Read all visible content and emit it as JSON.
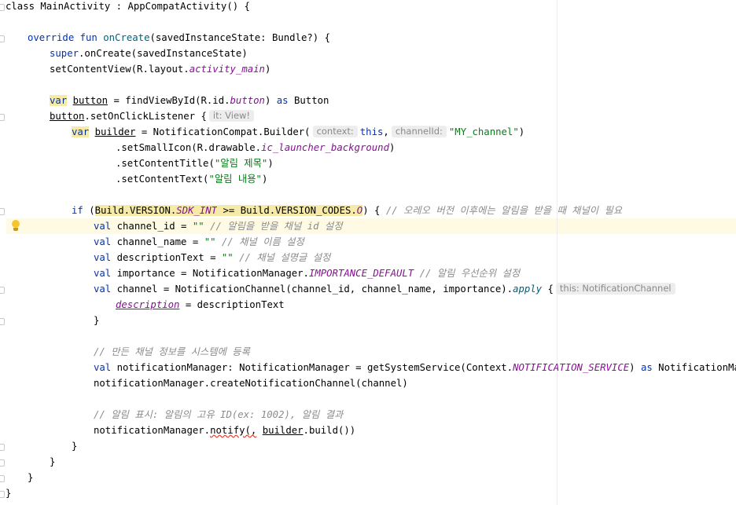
{
  "colors": {
    "keyword": "#0033b3",
    "function": "#00627a",
    "string": "#067d17",
    "comment": "#8c8c8c",
    "property": "#871094",
    "hint_bg": "#ededed",
    "current_line_bg": "#fffae3"
  },
  "icons": {
    "intention": "lightbulb-icon",
    "fold": "fold-marker-icon"
  },
  "code": {
    "l1": {
      "a": "class MainActivity : AppCompatActivity() {"
    },
    "l3": {
      "kw": "override fun ",
      "fn": "onCreate",
      "rest": "(savedInstanceState: Bundle?) {"
    },
    "l4": {
      "kw": "super",
      "rest": ".onCreate(savedInstanceState)"
    },
    "l5": {
      "a": "setContentView(R.layout.",
      "p": "activity_main",
      "b": ")"
    },
    "l7": {
      "kw": "var",
      "sp": " ",
      "var": "button",
      "a": " = findViewById(R.id.",
      "p": "button",
      "b": ") ",
      "kw2": "as",
      "c": " Button"
    },
    "l8": {
      "var": "button",
      "a": ".setOnClickListener {",
      "hint": "it: View!"
    },
    "l9": {
      "kw": "var",
      "sp": " ",
      "var": "builder",
      "a": " = NotificationCompat.Builder(",
      "hint1": "context:",
      "kw2": "this",
      "comma": ",",
      "hint2": "channelId:",
      "str": "\"MY_channel\"",
      "b": ")"
    },
    "l10": {
      "a": ".setSmallIcon(R.drawable.",
      "p": "ic_launcher_background",
      "b": ")"
    },
    "l11": {
      "a": ".setContentTitle(",
      "str": "\"알림 제목\"",
      "b": ")"
    },
    "l12": {
      "a": ".setContentText(",
      "str": "\"알림 내용\"",
      "b": ")"
    },
    "l14": {
      "kw": "if",
      "a": " (",
      "hl1": "Build.VERSION.",
      "hlp": "SDK_INT",
      "hl2": " >= Build.VERSION_CODES.",
      "hlo": "O",
      "b": ") { ",
      "cm": "// 오레오 버전 이후에는 알림을 받을 때 채널이 필요"
    },
    "l15": {
      "kw": "val",
      "a": " channel_id = ",
      "str": "\"\"",
      "sp": " ",
      "cm": "// 알림을 받을 채널 id 설정"
    },
    "l16": {
      "kw": "val",
      "a": " channel_name = ",
      "str": "\"\"",
      "sp": " ",
      "cm": "// 채널 이름 설정"
    },
    "l17": {
      "kw": "val",
      "a": " descriptionText = ",
      "str": "\"\"",
      "sp": " ",
      "cm": "// 채널 설명글 설정"
    },
    "l18": {
      "kw": "val",
      "a": " importance = NotificationManager.",
      "p": "IMPORTANCE_DEFAULT",
      "sp": " ",
      "cm": "// 알림 우선순위 설정"
    },
    "l19": {
      "kw": "val",
      "a": " channel = NotificationChannel(channel_id, channel_name, importance).",
      "fn": "apply",
      "b": " {",
      "hint": "this: NotificationChannel"
    },
    "l20": {
      "p": "description",
      "a": " = descriptionText"
    },
    "l21": {
      "a": "}"
    },
    "l23": {
      "cm": "// 만든 채널 정보를 시스템에 등록"
    },
    "l24": {
      "kw": "val",
      "a": " notificationManager: NotificationManager = getSystemService(Context.",
      "p": "NOTIFICATION_SERVICE",
      "b": ") ",
      "kw2": "as",
      "c": " NotificationManager"
    },
    "l25": {
      "a": "notificationManager.createNotificationChannel(channel)"
    },
    "l27": {
      "cm": "// 알림 표시: 알림의 고유 ID(ex: 1002), 알림 결과"
    },
    "l28": {
      "a": "notificationManager.",
      "sq": "notify(,",
      "b": " ",
      "var": "builder",
      "c": ".build())"
    },
    "l29": {
      "a": "}"
    },
    "l30": {
      "a": "}"
    },
    "l31": {
      "a": "}"
    },
    "l32": {
      "a": "}"
    }
  }
}
